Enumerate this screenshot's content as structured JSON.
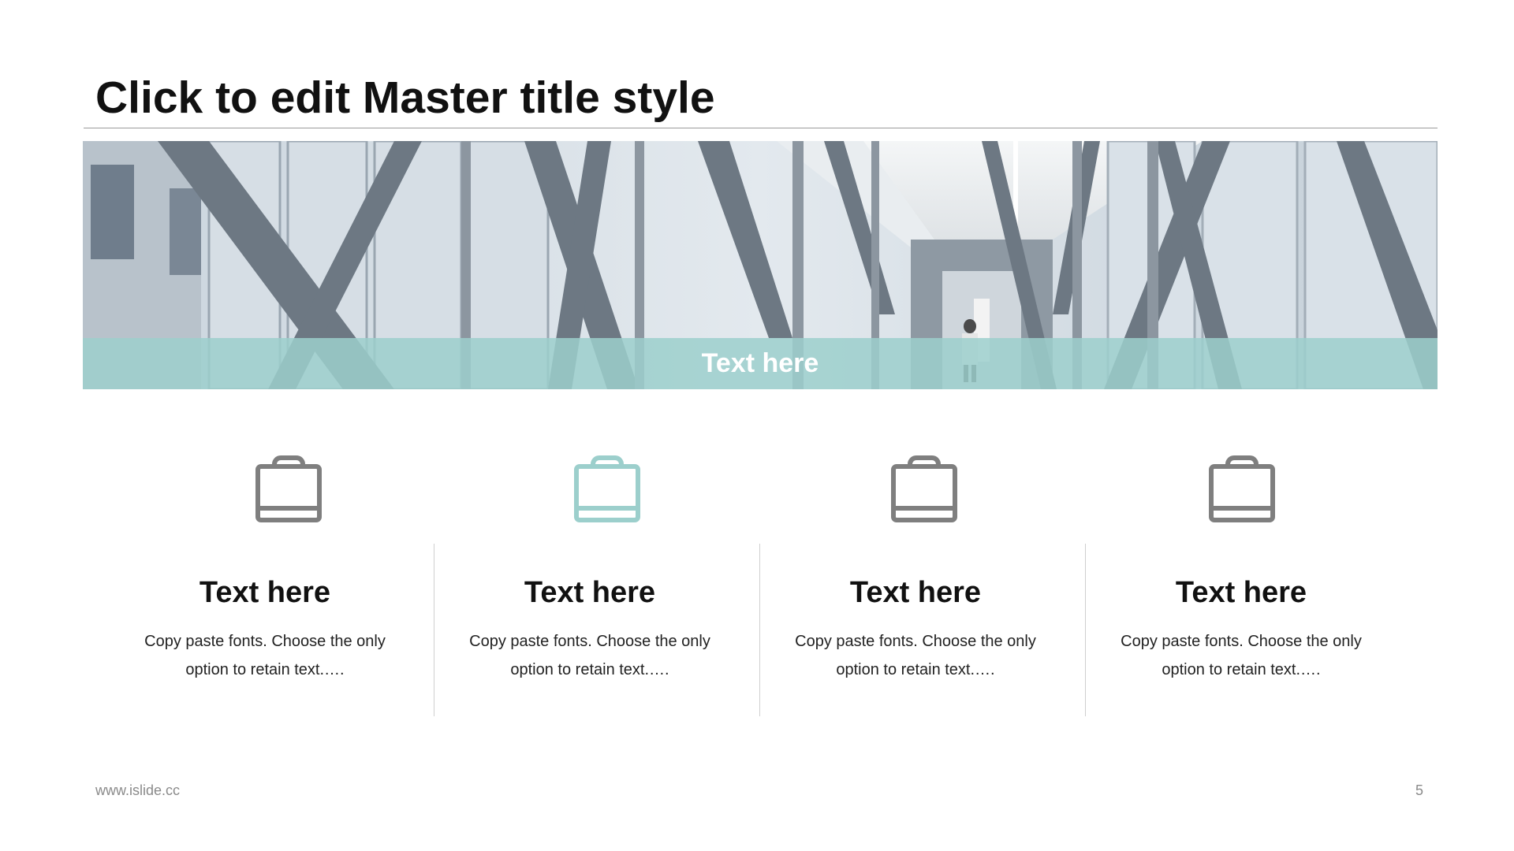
{
  "slide": {
    "title": "Click to edit Master title style",
    "banner_caption": "Text here",
    "footer_url": "www.islide.cc",
    "page_number": "5"
  },
  "colors": {
    "accent": "#9ccfcc",
    "icon_gray": "#7f7f7f",
    "title": "#111111"
  },
  "features": [
    {
      "icon": "shopping-bag-icon",
      "heading": "Text here",
      "desc": "Copy paste fonts. Choose the only option to retain text.….",
      "icon_color": "#7f7f7f"
    },
    {
      "icon": "shopping-bag-icon",
      "heading": "Text here",
      "desc": "Copy paste fonts. Choose the only option to retain text.….",
      "icon_color": "#9ccfcc"
    },
    {
      "icon": "shopping-bag-icon",
      "heading": "Text here",
      "desc": "Copy paste fonts. Choose the only option to retain text.….",
      "icon_color": "#7f7f7f"
    },
    {
      "icon": "shopping-bag-icon",
      "heading": "Text here",
      "desc": "Copy paste fonts. Choose the only option to retain text.….",
      "icon_color": "#7f7f7f"
    }
  ]
}
